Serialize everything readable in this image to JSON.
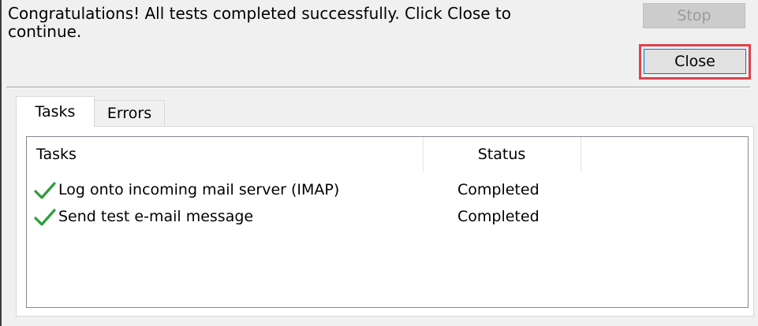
{
  "message": "Congratulations! All tests completed successfully. Click Close to continue.",
  "buttons": {
    "stop_label": "Stop",
    "close_label": "Close"
  },
  "tabs": [
    {
      "label": "Tasks",
      "active": true
    },
    {
      "label": "Errors",
      "active": false
    }
  ],
  "table": {
    "columns": [
      "Tasks",
      "Status"
    ],
    "rows": [
      {
        "task": "Log onto incoming mail server (IMAP)",
        "status": "Completed",
        "icon": "check-icon"
      },
      {
        "task": "Send test e-mail message",
        "status": "Completed",
        "icon": "check-icon"
      }
    ]
  },
  "colors": {
    "highlight": "#e0414b",
    "check": "#2e9b3b"
  }
}
